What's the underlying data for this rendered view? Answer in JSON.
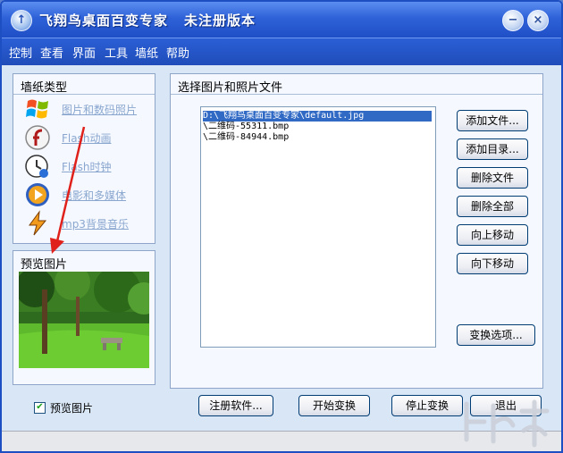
{
  "window": {
    "title": "飞翔鸟桌面百变专家",
    "title_status": "未注册版本",
    "minimize_glyph": "−",
    "close_glyph": "×",
    "app_icon_glyph": "↑"
  },
  "menu": [
    "控制",
    "查看",
    "界面",
    "工具",
    "墙纸",
    "帮助"
  ],
  "wallpaper_types": {
    "title": "墙纸类型",
    "items": [
      {
        "label": "图片和数码照片",
        "icon": "windows-flag-icon"
      },
      {
        "label": "Flash动画",
        "icon": "flash-icon"
      },
      {
        "label": "Flash时钟",
        "icon": "clock-icon"
      },
      {
        "label": "电影和多媒体",
        "icon": "media-player-icon"
      },
      {
        "label": "mp3背景音乐",
        "icon": "winamp-icon"
      }
    ]
  },
  "preview": {
    "title": "预览图片"
  },
  "file_panel": {
    "title": "选择图片和照片文件",
    "files": [
      "D:\\飞翔鸟桌面百变专家\\default.jpg",
      "\\二维码-55311.bmp",
      "\\二维码-84944.bmp"
    ],
    "selected_index": 0
  },
  "side_buttons": [
    "添加文件...",
    "添加目录...",
    "删除文件",
    "删除全部",
    "向上移动",
    "向下移动"
  ],
  "change_options_button": "变换选项...",
  "bottom_buttons": [
    "注册软件...",
    "开始变换",
    "停止变换",
    "退出"
  ],
  "preview_checkbox": {
    "label": "预览图片",
    "checked": true,
    "check_glyph": "✔"
  },
  "colors": {
    "accent": "#1f4fc6",
    "selection": "#316ac5",
    "annotation_arrow": "#e0201b"
  }
}
